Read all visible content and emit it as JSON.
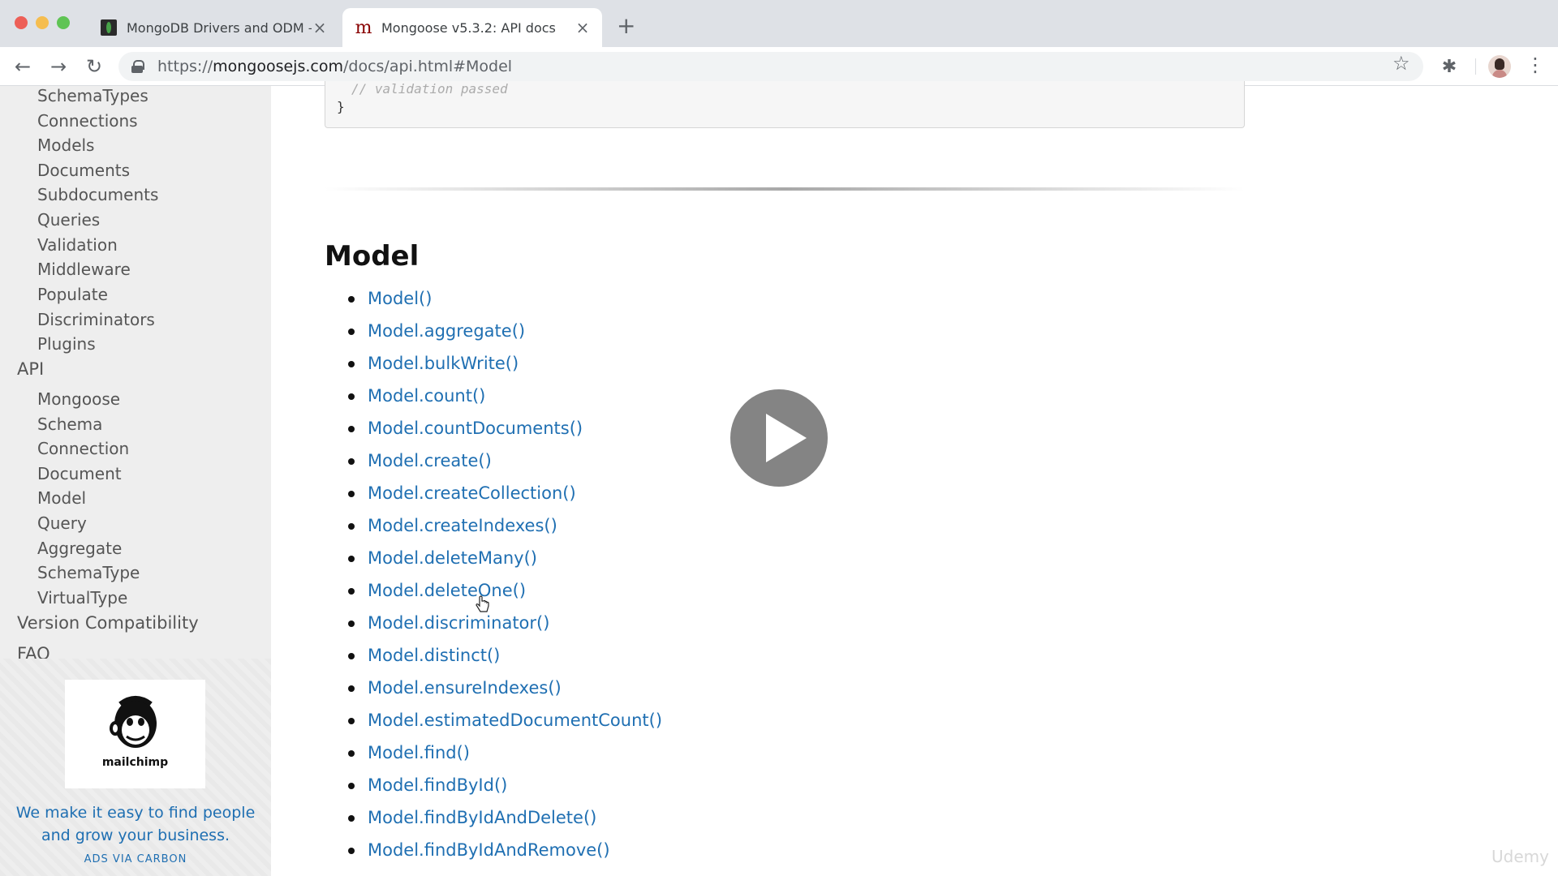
{
  "browser": {
    "tabs": [
      {
        "title": "MongoDB Drivers and ODM —",
        "active": false
      },
      {
        "title": "Mongoose v5.3.2: API docs",
        "active": true
      }
    ],
    "url_prefix": "https://",
    "url_host": "mongoosejs.com",
    "url_path": "/docs/api.html#Model"
  },
  "sidebar": {
    "guide_items": [
      "SchemaTypes",
      "Connections",
      "Models",
      "Documents",
      "Subdocuments",
      "Queries",
      "Validation",
      "Middleware",
      "Populate",
      "Discriminators",
      "Plugins"
    ],
    "api_heading": "API",
    "api_items": [
      "Mongoose",
      "Schema",
      "Connection",
      "Document",
      "Model",
      "Query",
      "Aggregate",
      "SchemaType",
      "VirtualType"
    ],
    "version_compat": "Version Compatibility",
    "faq": "FAQ",
    "ad": {
      "brand": "mailchimp",
      "text": "We make it easy to find people and grow your business.",
      "via": "ADS VIA CARBON"
    }
  },
  "main": {
    "code_comment": "// validation passed",
    "code_brace": "}",
    "heading": "Model",
    "methods": [
      "Model()",
      "Model.aggregate()",
      "Model.bulkWrite()",
      "Model.count()",
      "Model.countDocuments()",
      "Model.create()",
      "Model.createCollection()",
      "Model.createIndexes()",
      "Model.deleteMany()",
      "Model.deleteOne()",
      "Model.discriminator()",
      "Model.distinct()",
      "Model.ensureIndexes()",
      "Model.estimatedDocumentCount()",
      "Model.find()",
      "Model.findById()",
      "Model.findByIdAndDelete()",
      "Model.findByIdAndRemove()"
    ]
  },
  "overlay": {
    "watermark": "Udemy"
  },
  "colors": {
    "link": "#1f6fb2",
    "sidebar_bg": "#eeeeee"
  }
}
